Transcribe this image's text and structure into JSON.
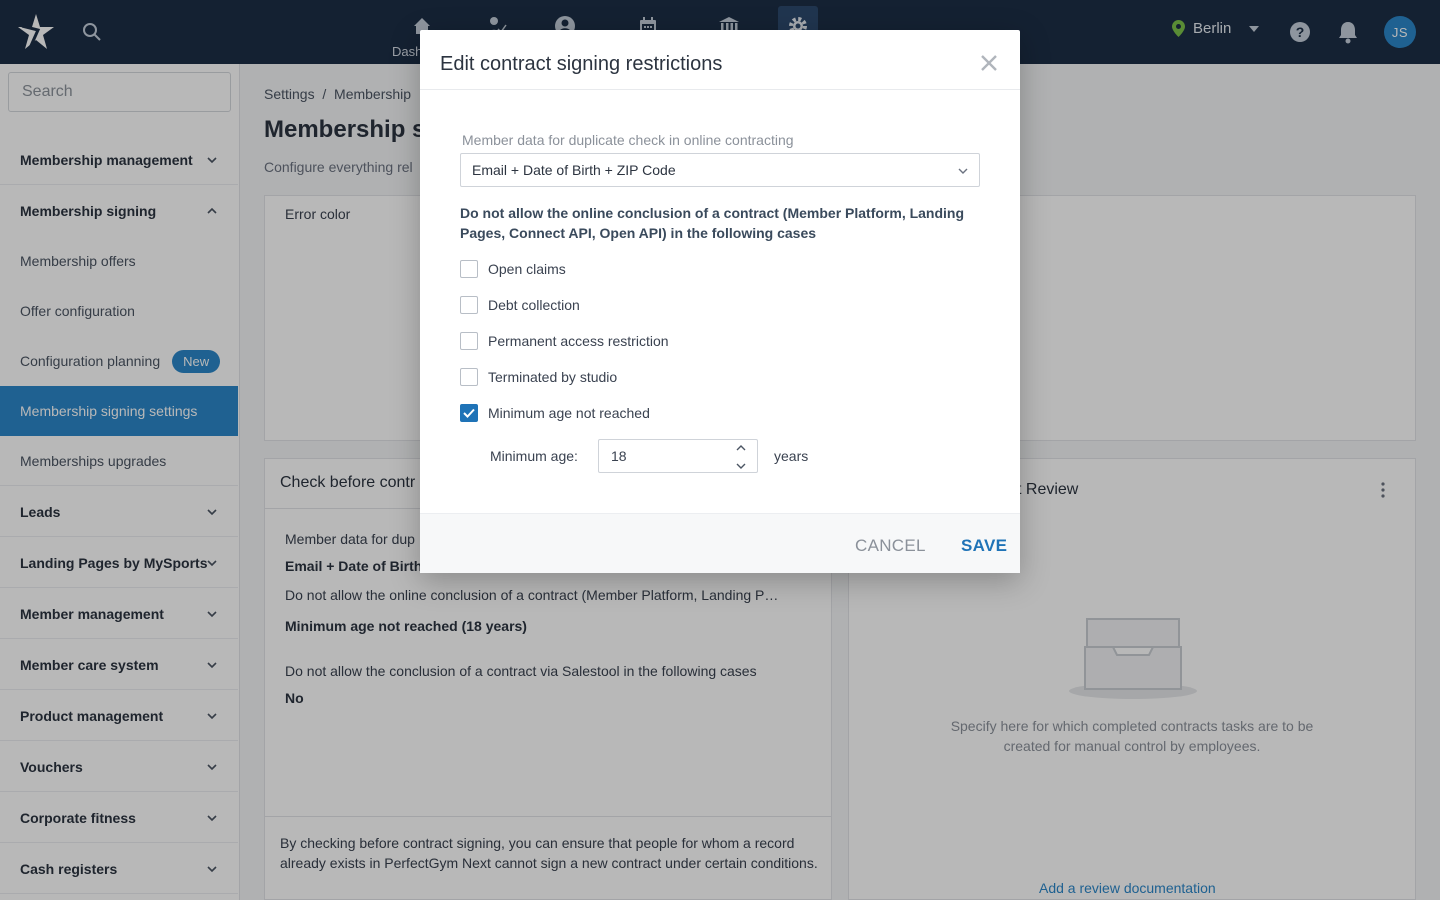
{
  "topbar": {
    "nav_label": "Dash",
    "location": "Berlin",
    "avatar_initials": "JS"
  },
  "sidebar": {
    "search_placeholder": "Search",
    "items": [
      {
        "label": "Membership management"
      },
      {
        "label": "Membership signing"
      },
      {
        "label": "Membership offers"
      },
      {
        "label": "Offer configuration"
      },
      {
        "label": "Configuration planning",
        "badge": "New"
      },
      {
        "label": "Membership signing settings"
      },
      {
        "label": "Memberships upgrades"
      },
      {
        "label": "Leads"
      },
      {
        "label": "Landing Pages by MySports"
      },
      {
        "label": "Member management"
      },
      {
        "label": "Member care system"
      },
      {
        "label": "Product management"
      },
      {
        "label": "Vouchers"
      },
      {
        "label": "Corporate fitness"
      },
      {
        "label": "Cash registers"
      }
    ]
  },
  "main": {
    "breadcrumb": "Settings  /  Membership",
    "title": "Membership s",
    "subtitle": "Configure everything rel",
    "error_color_label": "Error color",
    "check_card": {
      "title": "Check before contr",
      "member_data_label": "Member data for dup",
      "member_data_value": "Email + Date of Birth",
      "online_text": "Do not allow the online conclusion of a contract (Member Platform, Landing P…",
      "online_value": "Minimum age not reached (18 years)",
      "salestool_text": "Do not allow the conclusion of a contract via Salestool in the following cases",
      "salestool_value": "No",
      "footer_text": "By checking before contract signing, you can ensure that people for whom a record already exists in PerfectGym Next cannot sign a new contract under certain conditions."
    },
    "review_card": {
      "title": "ct Review",
      "empty_text": "Specify here for which completed contracts tasks are to be created for manual control by employees.",
      "link": "Add a review documentation"
    }
  },
  "modal": {
    "title": "Edit contract signing restrictions",
    "duplicate_label": "Member data for duplicate check in online contracting",
    "duplicate_value": "Email + Date of Birth + ZIP Code",
    "section_text": "Do not allow the online conclusion of a contract (Member Platform, Landing Pages, Connect API, Open API) in the following cases",
    "options": [
      {
        "label": "Open claims",
        "checked": false
      },
      {
        "label": "Debt collection",
        "checked": false
      },
      {
        "label": "Permanent access restriction",
        "checked": false
      },
      {
        "label": "Terminated by studio",
        "checked": false
      },
      {
        "label": "Minimum age not reached",
        "checked": true
      }
    ],
    "min_age_label": "Minimum age:",
    "min_age_value": "18",
    "years_label": "years",
    "cancel_label": "CANCEL",
    "save_label": "SAVE"
  },
  "colors": {
    "topbar": "#1d2f46",
    "accent": "#2b87c9",
    "checkbox_checked": "#1f73b7"
  }
}
